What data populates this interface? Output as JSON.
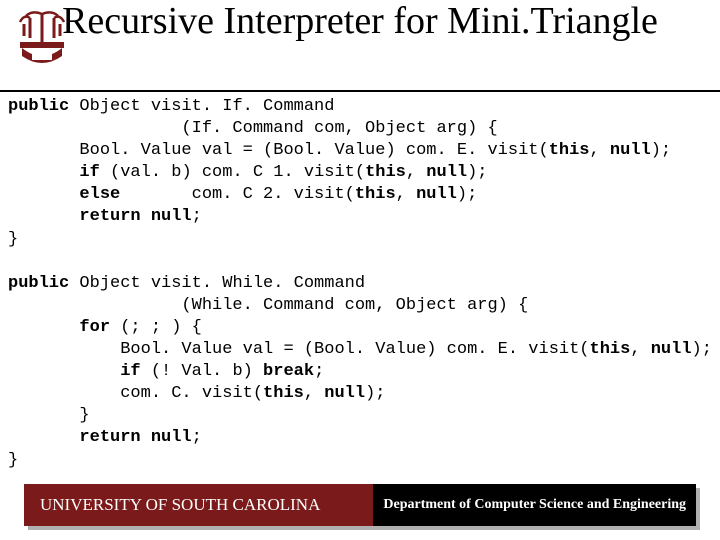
{
  "title": "Recursive Interpreter for Mini.Triangle",
  "code": {
    "l01a": "public",
    "l01b": " Object visit. If. Command",
    "l02": "                 (If. Command com, Object arg) {",
    "l03": "       Bool. Value val = (Bool. Value) com. E. visit(",
    "l03a": "this",
    "l03b": ", ",
    "l03c": "null",
    "l03d": ");",
    "l04a": "       if",
    "l04b": " (val. b) com. C 1. visit(",
    "l04c": "this",
    "l04d": ", ",
    "l04e": "null",
    "l04f": ");",
    "l05a": "       else",
    "l05b": "       com. C 2. visit(",
    "l05c": "this",
    "l05d": ", ",
    "l05e": "null",
    "l05f": ");",
    "l06a": "       return null",
    "l06b": ";",
    "l07": "}",
    "b01a": "public",
    "b01b": " Object visit. While. Command",
    "b02": "                 (While. Command com, Object arg) {",
    "b03a": "       for",
    "b03b": " (; ; ) {",
    "b04": "           Bool. Value val = (Bool. Value) com. E. visit(",
    "b04a": "this",
    "b04b": ", ",
    "b04c": "null",
    "b04d": ");",
    "b05a": "           if",
    "b05b": " (! Val. b) ",
    "b05c": "break",
    "b05d": ";",
    "b06": "           com. C. visit(",
    "b06a": "this",
    "b06b": ", ",
    "b06c": "null",
    "b06d": ");",
    "b07": "       }",
    "b08a": "       return null",
    "b08b": ";",
    "b09": "}"
  },
  "footer": {
    "left": "UNIVERSITY OF SOUTH CAROLINA",
    "right": "Department of Computer Science and Engineering"
  },
  "colors": {
    "garnet": "#7a1a1a"
  }
}
